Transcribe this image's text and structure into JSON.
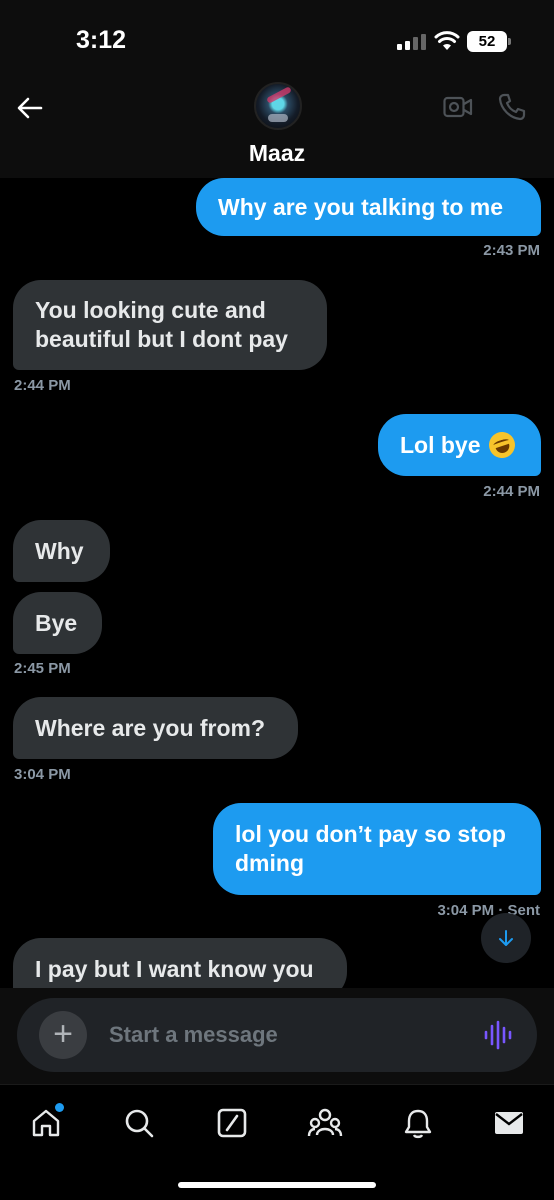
{
  "status_bar": {
    "time": "3:12",
    "battery": "52"
  },
  "header": {
    "contact_name": "Maaz"
  },
  "messages": [
    {
      "text": "Why are you talking to me"
    },
    {
      "text": "You looking cute and",
      "text2": "beautiful but I dont pay"
    },
    {
      "text": "Lol bye"
    },
    {
      "text": "Why"
    },
    {
      "text": "Bye"
    },
    {
      "text": "Where are you from?"
    },
    {
      "text": "lol you don’t pay so stop",
      "text2": "dming"
    },
    {
      "text": "I pay but I want know you"
    }
  ],
  "timestamps": [
    "2:43 PM",
    "2:44 PM",
    "2:44 PM",
    "2:45 PM",
    "3:04 PM",
    "3:04 PM · Sent"
  ],
  "composer": {
    "placeholder": "Start a message"
  },
  "colors": {
    "accent": "#1d9bf0",
    "incoming_bubble": "#2f3336",
    "background": "#000000"
  },
  "icons": [
    "back-arrow-icon",
    "video-call-icon",
    "phone-icon",
    "plus-icon",
    "voice-wave-icon",
    "home-icon",
    "search-icon",
    "grok-icon",
    "communities-icon",
    "bell-icon",
    "mail-icon",
    "arrow-down-icon"
  ]
}
